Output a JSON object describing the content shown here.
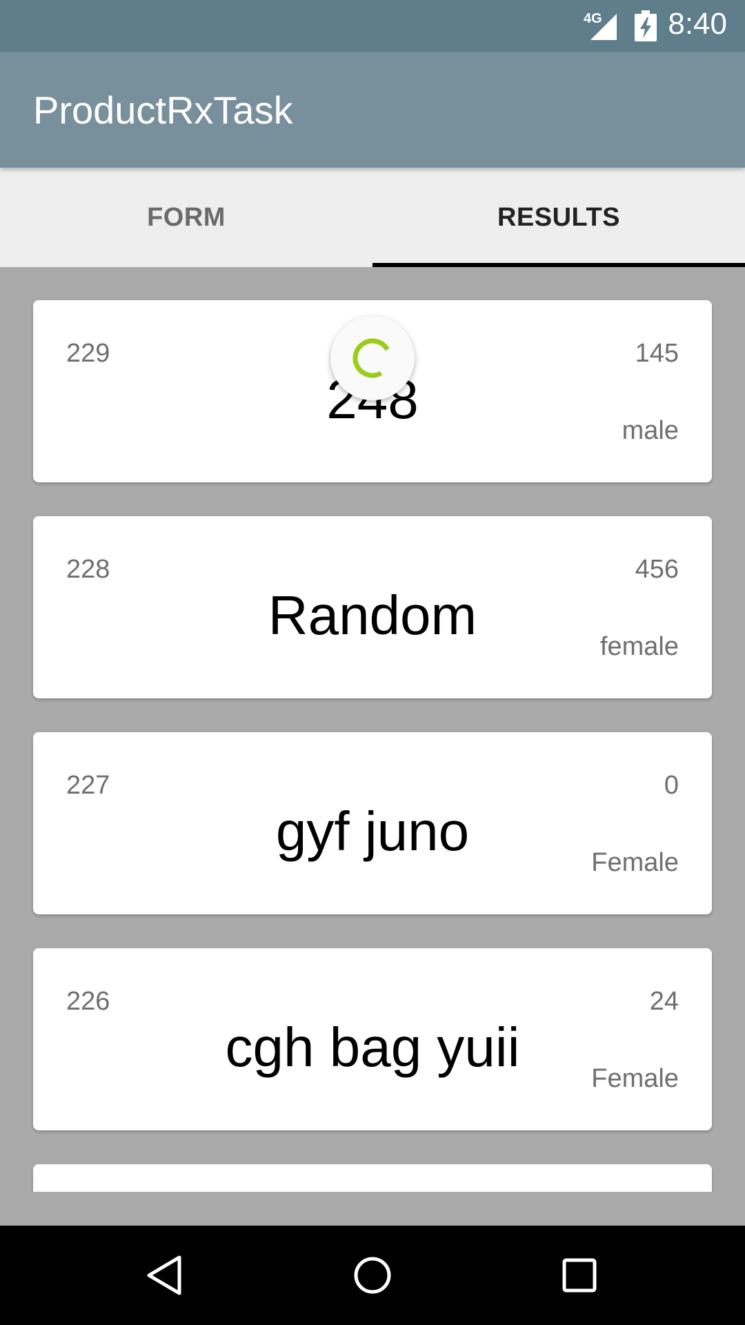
{
  "status_bar": {
    "network": "4G",
    "time": "8:40",
    "icons": [
      "signal-icon",
      "battery-charging-icon"
    ]
  },
  "app_bar": {
    "title": "ProductRxTask"
  },
  "tabs": [
    {
      "label": "FORM",
      "selected": false
    },
    {
      "label": "RESULTS",
      "selected": true
    }
  ],
  "results": [
    {
      "id": "229",
      "name": "248",
      "age": "145",
      "gender": "male"
    },
    {
      "id": "228",
      "name": "Random",
      "age": "456",
      "gender": "female"
    },
    {
      "id": "227",
      "name": "gyf juno",
      "age": "0",
      "gender": "Female"
    },
    {
      "id": "226",
      "name": "cgh bag yuii",
      "age": "24",
      "gender": "Female"
    }
  ],
  "loading_indicator": {
    "icon": "progress-spinner-icon",
    "color": "#9ccc1a"
  },
  "nav_bar": {
    "buttons": [
      "back-icon",
      "home-icon",
      "recents-icon"
    ]
  }
}
